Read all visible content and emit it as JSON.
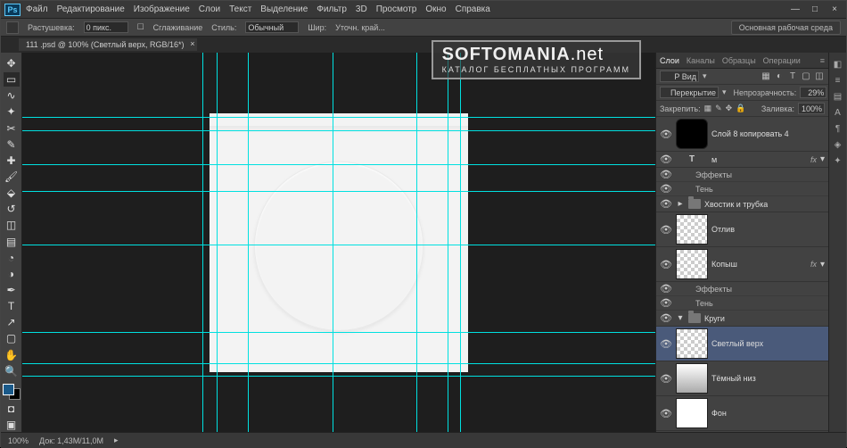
{
  "app_logo": "Ps",
  "menu": {
    "file": "Файл",
    "edit": "Редактирование",
    "image": "Изображение",
    "layer": "Слои",
    "text": "Текст",
    "select": "Выделение",
    "filter": "Фильтр",
    "3d": "3D",
    "view": "Просмотр",
    "window": "Окно",
    "help": "Справка"
  },
  "window_controls": {
    "min": "—",
    "max": "□",
    "close": "×"
  },
  "options": {
    "feather_label": "Растушевка:",
    "feather_value": "0 пикс.",
    "antialias": "Сглаживание",
    "style_label": "Стиль:",
    "style_value": "Обычный",
    "width_label": "Шир:",
    "extra": "Уточн. край...",
    "workspace": "Основная рабочая среда"
  },
  "doc_tab": {
    "title": "111 .psd @ 100% (Светлый верх, RGB/16*)",
    "close": "×"
  },
  "panel": {
    "tabs": {
      "layers": "Слои",
      "channels": "Каналы",
      "paths": "Образцы",
      "history": "Операции"
    },
    "kind": "P Вид",
    "blend_label": "Перекрытие",
    "opacity_label": "Непрозрачность:",
    "opacity": "29%",
    "lock_label": "Закрепить:",
    "fill_label": "Заливка:",
    "fill": "100%"
  },
  "layers": {
    "l1": "Слой 8 копировать 4",
    "text_layer": "м",
    "effects": "Эффекты",
    "shadow": "Тень",
    "group1": "Хвостик и трубка",
    "l2": "Отлив",
    "l3": "Копыш",
    "group2": "Круги",
    "l4": "Светлый верх",
    "l5": "Тёмный низ",
    "l6": "Фон",
    "fx": "fx"
  },
  "status": {
    "zoom": "100%",
    "doc": "Док: 1,43M/11,0M"
  },
  "watermark": {
    "line1a": "SOFTOMANIA",
    "line1b": ".net",
    "line2": "КАТАЛОГ БЕСПЛАТНЫХ ПРОГРАММ"
  }
}
